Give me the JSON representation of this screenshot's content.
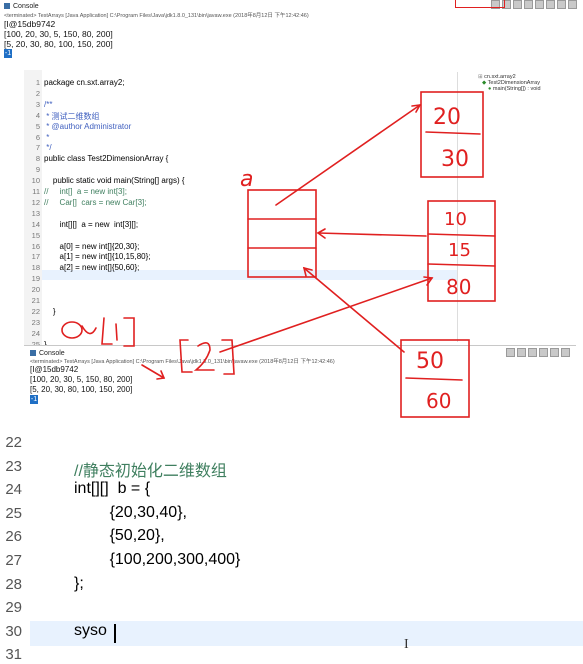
{
  "top_console": {
    "title": "Console",
    "terminated": "<terminated> TestArrays [Java Application] C:\\Program Files\\Java\\jdk1.8.0_131\\bin\\javaw.exe (2018年8月12日 下午12:42:46)",
    "lines": [
      "[I@15db9742",
      "[100, 20, 30, 5, 150, 80, 200]",
      "[5, 20, 30, 80, 100, 150, 200]"
    ],
    "caret": "-1"
  },
  "editor": {
    "lines": [
      {
        "n": "1",
        "text": "package cn.sxt.array2;"
      },
      {
        "n": "2",
        "text": ""
      },
      {
        "n": "3",
        "text": "/**"
      },
      {
        "n": "4",
        "text": " * 测试二维数组"
      },
      {
        "n": "5",
        "text": " * @author Administrator"
      },
      {
        "n": "6",
        "text": " *"
      },
      {
        "n": "7",
        "text": " */"
      },
      {
        "n": "8",
        "text": "public class Test2DimensionArray {"
      },
      {
        "n": "9",
        "text": ""
      },
      {
        "n": "10",
        "text": "    public static void main(String[] args) {"
      },
      {
        "n": "11",
        "text": "//     int[]  a = new int[3];"
      },
      {
        "n": "12",
        "text": "//     Car[]  cars = new Car[3];"
      },
      {
        "n": "13",
        "text": ""
      },
      {
        "n": "14",
        "text": "       int[][]  a = new  int[3][];"
      },
      {
        "n": "15",
        "text": ""
      },
      {
        "n": "16",
        "text": "       a[0] = new int[]{20,30};"
      },
      {
        "n": "17",
        "text": "       a[1] = new int[]{10,15,80};"
      },
      {
        "n": "18",
        "text": "       a[2] = new int[]{50,60};"
      },
      {
        "n": "19",
        "text": ""
      },
      {
        "n": "20",
        "text": ""
      },
      {
        "n": "21",
        "text": ""
      },
      {
        "n": "22",
        "text": "    }"
      },
      {
        "n": "23",
        "text": ""
      },
      {
        "n": "24",
        "text": ""
      },
      {
        "n": "25",
        "text": "}"
      },
      {
        "n": "26",
        "text": ""
      }
    ],
    "outline": {
      "package": "cn.sxt.array2",
      "class": "Test2DimensionArray",
      "method": "main(String[]) : void"
    }
  },
  "mid_console": {
    "title": "Console",
    "terminated": "<terminated> TestArrays [Java Application] C:\\Program Files\\Java\\jdk1.8.0_131\\bin\\javaw.exe (2018年8月12日 下午12:42:46)",
    "lines": [
      "[I@15db9742",
      "[100, 20, 30, 5, 150, 80, 200]",
      "[5, 20, 30, 80, 100, 150, 200]"
    ],
    "caret": "-1"
  },
  "annotations": {
    "label_a": "a",
    "box1": [
      "20",
      "30"
    ],
    "box2": [
      "10",
      "15",
      "80"
    ],
    "box3": [
      "50",
      "60"
    ],
    "a_expr": "a[1][2]",
    "ink_color": "#e02020"
  },
  "big_code": {
    "lines": [
      {
        "n": "22",
        "text": ""
      },
      {
        "n": "23",
        "text": "//静态初始化二维数组"
      },
      {
        "n": "24",
        "text": "int[][]  b = {"
      },
      {
        "n": "25",
        "text": "        {20,30,40},"
      },
      {
        "n": "26",
        "text": "        {50,20},"
      },
      {
        "n": "27",
        "text": "        {100,200,300,400}"
      },
      {
        "n": "28",
        "text": "};"
      },
      {
        "n": "29",
        "text": ""
      },
      {
        "n": "30",
        "text": "syso"
      },
      {
        "n": "31",
        "text": ""
      }
    ]
  },
  "colors": {
    "keyword": "#7f0055",
    "comment": "#3f7f5f",
    "javadoc": "#3f5fbf",
    "current_line": "#e8f2fe",
    "console_selection": "#1f6fc5"
  }
}
